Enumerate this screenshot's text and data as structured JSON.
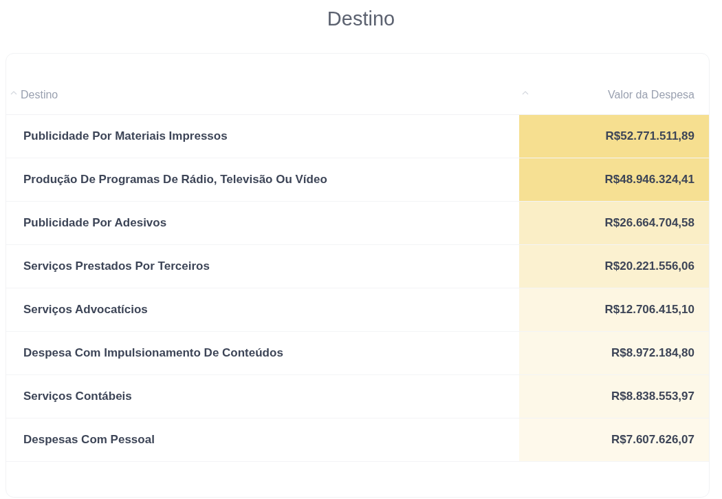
{
  "title": "Destino",
  "table": {
    "columns": [
      {
        "label": "Destino"
      },
      {
        "label": "Valor da Despesa"
      }
    ],
    "rows": [
      {
        "destino": "Publicidade Por Materiais Impressos",
        "valor": "R$52.771.511,89",
        "color": "#f6df90"
      },
      {
        "destino": "Produção De Programas De Rádio, Televisão Ou Vídeo",
        "valor": "R$48.946.324,41",
        "color": "#f6e093"
      },
      {
        "destino": "Publicidade Por Adesivos",
        "valor": "R$26.664.704,58",
        "color": "#faeec6"
      },
      {
        "destino": "Serviços Prestados Por Terceiros",
        "valor": "R$20.221.556,06",
        "color": "#fbf1d0"
      },
      {
        "destino": "Serviços Advocatícios",
        "valor": "R$12.706.415,10",
        "color": "#fdf6e2"
      },
      {
        "destino": "Despesa Com Impulsionamento De Conteúdos",
        "valor": "R$8.972.184,80",
        "color": "#fdf8e8"
      },
      {
        "destino": "Serviços Contábeis",
        "valor": "R$8.838.553,97",
        "color": "#fdf8e8"
      },
      {
        "destino": "Despesas Com Pessoal",
        "valor": "R$7.607.626,07",
        "color": "#fef9eb"
      }
    ]
  }
}
